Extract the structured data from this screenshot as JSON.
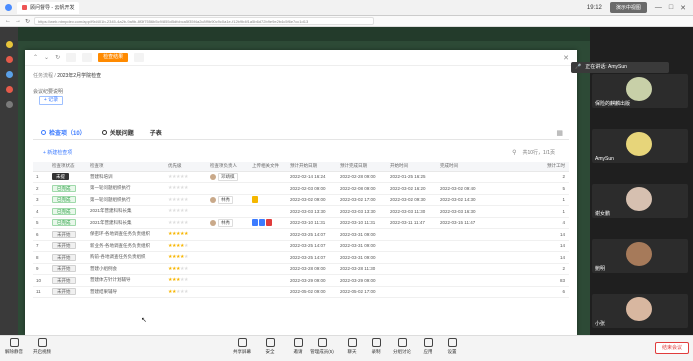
{
  "browser": {
    "tab_title": "顾问督导 - 云帆开发",
    "url": "https://web.ntmpdev.com/app/f9d401b-2345-4a2b-9a9b-8f3f7556b5c9/855d5dfcbca5f35f4a2c8f9b90c9c0a1e-f12b9b4f1a5b6d72b9e9e2b4c5f6e7cc1d13",
    "present_label": "演示中视图",
    "clock": "19:12",
    "minimize": "—",
    "maximize": "□",
    "close": "✕"
  },
  "dialog": {
    "steps": [
      "",
      "",
      "检查结果",
      ""
    ],
    "active_step_index": 2,
    "breadcrumb_root": "任务流程",
    "breadcrumb_sep": "/",
    "breadcrumb_current": "2023年2月学院检查",
    "section_label": "会议纪要说明",
    "add_label": "+ 记录",
    "tabs": [
      {
        "label": "检查项（10）",
        "active": true
      },
      {
        "label": "关联问题",
        "active": false
      },
      {
        "label": "子表",
        "active": false
      }
    ],
    "new_item_label": "+ 新建检查项",
    "pager": "共10行，1/1页",
    "columns": [
      "检查项状态",
      "检查项",
      "优先级",
      "检查项负责人",
      "上传相关文件",
      "预计开始日期",
      "预计完成日期",
      "开始时间",
      "完成时间",
      "预计工时"
    ],
    "rows": [
      {
        "no": "1",
        "status": "未提",
        "status_type": "black",
        "item": "营建科培训",
        "stars": 0,
        "owner": "邓靖棋",
        "files": [],
        "plan_start": "2022-02-14 16:24",
        "plan_end": "2022-02-28 09:00",
        "start": "2022-01-25 16:25",
        "end": "",
        "hours": "2"
      },
      {
        "no": "2",
        "status": "已完成",
        "status_type": "green",
        "item": "第一轮问题组织执行",
        "stars": 0,
        "owner": "",
        "files": [],
        "plan_start": "2022-02-03 09:00",
        "plan_end": "2022-02-08 09:00",
        "start": "2022-03-02 16:20",
        "end": "2022-03-02 09:40",
        "hours": "5"
      },
      {
        "no": "3",
        "status": "已完成",
        "status_type": "green",
        "item": "第一轮问题组织执行",
        "stars": 0,
        "owner": "林秀",
        "files": [
          "yellow"
        ],
        "plan_start": "2022-03-02 09:00",
        "plan_end": "2022-03-02 17:00",
        "start": "2022-03-02 09:30",
        "end": "2022-03-02 14:30",
        "hours": "1"
      },
      {
        "no": "4",
        "status": "已完成",
        "status_type": "green",
        "item": "2021年营建科科长集",
        "stars": 0,
        "owner": "",
        "files": [],
        "plan_start": "2022-03-03 13:30",
        "plan_end": "2022-03-03 13:30",
        "start": "2022-03-03 11:30",
        "end": "2022-03-03 16:30",
        "hours": "1"
      },
      {
        "no": "5",
        "status": "已完成",
        "status_type": "green",
        "item": "2021年营建科科长集",
        "stars": 0,
        "owner": "林秀",
        "files": [
          "blue",
          "blue",
          "red"
        ],
        "plan_start": "2022-03-10 11:31",
        "plan_end": "2022-03-10 11:31",
        "start": "2022-03-11 11:47",
        "end": "2022-03-15 11:47",
        "hours": "4"
      },
      {
        "no": "6",
        "status": "未开始",
        "status_type": "grey",
        "item": "保密环-各地调查任务负责组织",
        "stars": 5,
        "owner": "",
        "files": [],
        "plan_start": "2022-03-25 14:07",
        "plan_end": "2022-03-31 09:00",
        "start": "",
        "end": "",
        "hours": "14"
      },
      {
        "no": "7",
        "status": "未开始",
        "status_type": "grey",
        "item": "新业务-各地调查任务负责组织",
        "stars": 4,
        "owner": "",
        "files": [],
        "plan_start": "2022-03-25 14:07",
        "plan_end": "2022-03-31 09:00",
        "start": "",
        "end": "",
        "hours": "14"
      },
      {
        "no": "8",
        "status": "未开始",
        "status_type": "grey",
        "item": "购前-各地调查任务负责组织",
        "stars": 4,
        "owner": "",
        "files": [],
        "plan_start": "2022-03-25 14:07",
        "plan_end": "2022-03-31 09:00",
        "start": "",
        "end": "",
        "hours": "14"
      },
      {
        "no": "9",
        "status": "未开始",
        "status_type": "grey",
        "item": "营建小组例会",
        "stars": 3,
        "owner": "",
        "files": [],
        "plan_start": "2022-03-28 09:00",
        "plan_end": "2022-03-28 11:30",
        "start": "",
        "end": "",
        "hours": "2"
      },
      {
        "no": "10",
        "status": "未开始",
        "status_type": "grey",
        "item": "营建体方针计划辅导",
        "stars": 3,
        "owner": "",
        "files": [],
        "plan_start": "2022-03-29 09:00",
        "plan_end": "2022-03-29 09:00",
        "start": "",
        "end": "",
        "hours": "83"
      },
      {
        "no": "11",
        "status": "未开始",
        "status_type": "grey",
        "item": "营建结果辅导",
        "stars": 2,
        "owner": "",
        "files": [],
        "plan_start": "2022-05-02 09:00",
        "plan_end": "2022-05-02 17:00",
        "start": "",
        "end": "",
        "hours": "6"
      }
    ]
  },
  "meeting": {
    "speaking_tip": "正在讲话: AmySun",
    "participants": [
      {
        "name": "保险的麒麟出版"
      },
      {
        "name": "AmySun"
      },
      {
        "name": "谢女鹏"
      },
      {
        "name": "鲍明"
      },
      {
        "name": "小张"
      }
    ],
    "toolbar": [
      {
        "label": "解除静音"
      },
      {
        "label": "开启视频"
      },
      {
        "label": "共享屏幕"
      },
      {
        "label": "安全"
      },
      {
        "label": "邀请"
      },
      {
        "label": "管理成员(5)"
      },
      {
        "label": "聊天"
      },
      {
        "label": "录制"
      },
      {
        "label": "分组讨论"
      },
      {
        "label": "应用"
      },
      {
        "label": "设置"
      }
    ],
    "end_label": "结束会议"
  },
  "colors": {
    "accent": "#3c7bff",
    "active_step": "#ff8a00",
    "star": "#f7b500",
    "end": "#e03c3c"
  }
}
